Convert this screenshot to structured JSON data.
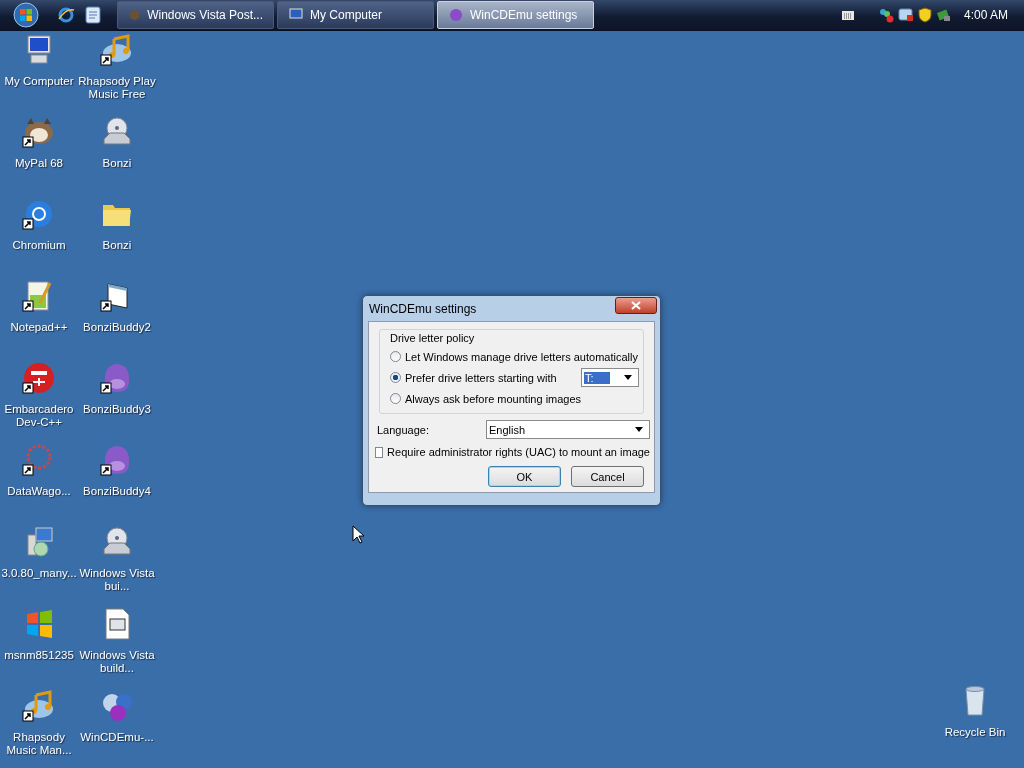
{
  "taskbar": {
    "tasks": [
      {
        "label": "Windows Vista Post...",
        "selected": false
      },
      {
        "label": "My Computer",
        "selected": false
      },
      {
        "label": "WinCDEmu settings",
        "selected": true
      }
    ],
    "clock": "4:00 AM"
  },
  "desktop": {
    "icons": [
      {
        "label": "My Computer",
        "shortcut": false
      },
      {
        "label": "Rhapsody Play Music Free",
        "shortcut": true
      },
      {
        "label": "MyPal 68",
        "shortcut": true
      },
      {
        "label": "Bonzi",
        "shortcut": false
      },
      {
        "label": "Chromium",
        "shortcut": true
      },
      {
        "label": "Bonzi",
        "shortcut": false
      },
      {
        "label": "Notepad++",
        "shortcut": true
      },
      {
        "label": "BonziBuddy2",
        "shortcut": true
      },
      {
        "label": "Embarcadero Dev-C++",
        "shortcut": true
      },
      {
        "label": "BonziBuddy3",
        "shortcut": true
      },
      {
        "label": "DataWago...",
        "shortcut": true
      },
      {
        "label": "BonziBuddy4",
        "shortcut": true
      },
      {
        "label": "3.0.80_many...",
        "shortcut": false
      },
      {
        "label": "Windows Vista bui...",
        "shortcut": false
      },
      {
        "label": "msnm851235",
        "shortcut": false
      },
      {
        "label": "Windows Vista build...",
        "shortcut": false
      },
      {
        "label": "Rhapsody Music Man...",
        "shortcut": true
      },
      {
        "label": "WinCDEmu-...",
        "shortcut": false
      }
    ],
    "recycle_bin": {
      "label": "Recycle Bin"
    }
  },
  "dialog": {
    "title": "WinCDEmu settings",
    "group": {
      "title": "Drive letter policy",
      "options": [
        {
          "label": "Let Windows manage drive letters automatically",
          "selected": false
        },
        {
          "label": "Prefer drive letters starting with",
          "selected": true
        },
        {
          "label": "Always ask before mounting images",
          "selected": false
        }
      ],
      "drive_letter": "T:"
    },
    "language": {
      "label": "Language:",
      "value": "English"
    },
    "uac": {
      "label": "Require administrator rights (UAC) to mount an image",
      "checked": false
    },
    "buttons": [
      {
        "label": "OK",
        "default": true
      },
      {
        "label": "Cancel",
        "default": false
      }
    ]
  }
}
